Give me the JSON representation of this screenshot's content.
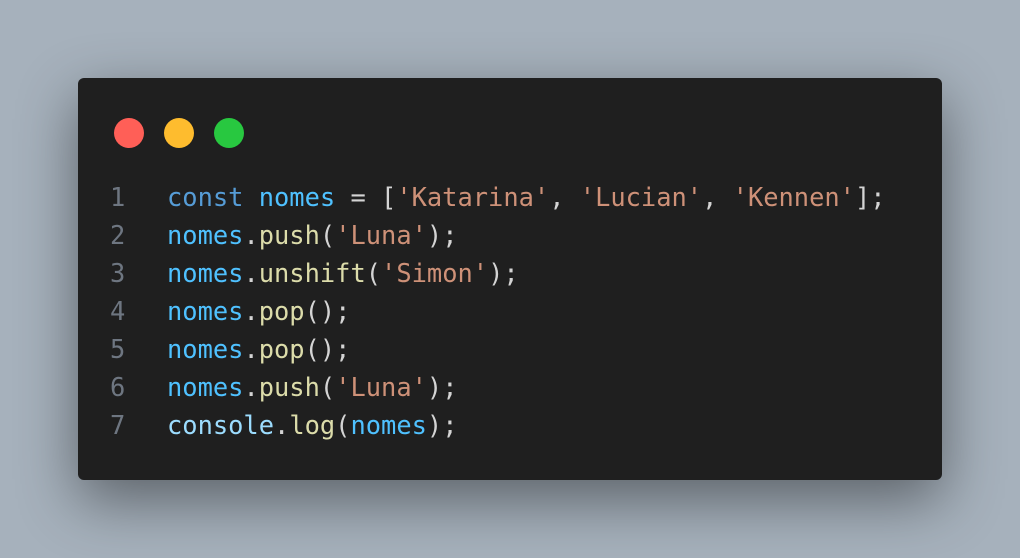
{
  "window_controls": [
    {
      "name": "close",
      "color": "#ff5f57"
    },
    {
      "name": "minimize",
      "color": "#febc2e"
    },
    {
      "name": "maximize",
      "color": "#28c840"
    }
  ],
  "colors": {
    "keyword": "#569cd6",
    "variable": "#4fc1ff",
    "function": "#dcdcaa",
    "string": "#ce9178",
    "punct": "#d4d4d4",
    "object": "#9cdcfe"
  },
  "lines": [
    {
      "number": "1",
      "tokens": [
        [
          "const",
          "keyword"
        ],
        [
          " ",
          "punct"
        ],
        [
          "nomes",
          "variable"
        ],
        [
          " = [",
          "punct"
        ],
        [
          "'Katarina'",
          "string"
        ],
        [
          ", ",
          "punct"
        ],
        [
          "'Lucian'",
          "string"
        ],
        [
          ", ",
          "punct"
        ],
        [
          "'Kennen'",
          "string"
        ],
        [
          "];",
          "punct"
        ]
      ]
    },
    {
      "number": "2",
      "tokens": [
        [
          "nomes",
          "variable"
        ],
        [
          ".",
          "punct"
        ],
        [
          "push",
          "function"
        ],
        [
          "(",
          "punct"
        ],
        [
          "'Luna'",
          "string"
        ],
        [
          ");",
          "punct"
        ]
      ]
    },
    {
      "number": "3",
      "tokens": [
        [
          "nomes",
          "variable"
        ],
        [
          ".",
          "punct"
        ],
        [
          "unshift",
          "function"
        ],
        [
          "(",
          "punct"
        ],
        [
          "'Simon'",
          "string"
        ],
        [
          ");",
          "punct"
        ]
      ]
    },
    {
      "number": "4",
      "tokens": [
        [
          "nomes",
          "variable"
        ],
        [
          ".",
          "punct"
        ],
        [
          "pop",
          "function"
        ],
        [
          "();",
          "punct"
        ]
      ]
    },
    {
      "number": "5",
      "tokens": [
        [
          "nomes",
          "variable"
        ],
        [
          ".",
          "punct"
        ],
        [
          "pop",
          "function"
        ],
        [
          "();",
          "punct"
        ]
      ]
    },
    {
      "number": "6",
      "tokens": [
        [
          "nomes",
          "variable"
        ],
        [
          ".",
          "punct"
        ],
        [
          "push",
          "function"
        ],
        [
          "(",
          "punct"
        ],
        [
          "'Luna'",
          "string"
        ],
        [
          ");",
          "punct"
        ]
      ]
    },
    {
      "number": "7",
      "tokens": [
        [
          "console",
          "object"
        ],
        [
          ".",
          "punct"
        ],
        [
          "log",
          "function"
        ],
        [
          "(",
          "punct"
        ],
        [
          "nomes",
          "variable"
        ],
        [
          ");",
          "punct"
        ]
      ]
    }
  ]
}
